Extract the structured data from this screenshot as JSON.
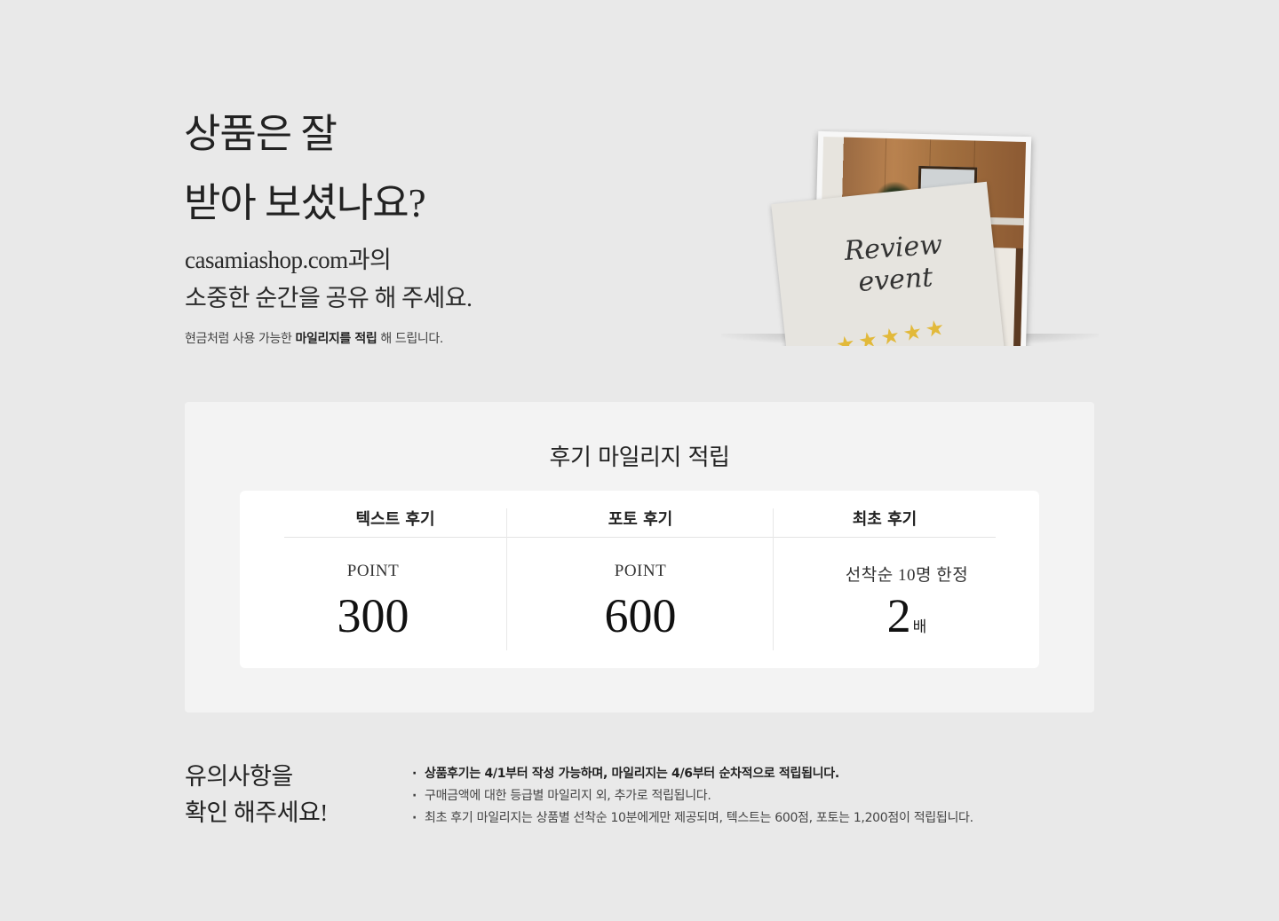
{
  "hero": {
    "title_line1": "상품은 잘",
    "title_line2": "받아 보셨나요?",
    "sub_line1": "casamiashop.com과의",
    "sub_line2": "소중한 순간을 공유 해 주세요.",
    "note_prefix": "현금처럼 사용 가능한 ",
    "note_bold": "마일리지를 적립",
    "note_suffix": " 해 드립니다."
  },
  "illustration": {
    "card_line1": "Review",
    "card_line2": "event",
    "stars": "★★★★★",
    "star_color": "#e2b93a"
  },
  "mileage": {
    "title": "후기 마일리지 적립",
    "columns": [
      {
        "header": "텍스트 후기",
        "label": "POINT",
        "value": "300",
        "unit": ""
      },
      {
        "header": "포토 후기",
        "label": "POINT",
        "value": "600",
        "unit": ""
      },
      {
        "header": "최초 후기",
        "label": "선착순 10명 한정",
        "value": "2",
        "unit": "배"
      }
    ]
  },
  "notice": {
    "title_line1": "유의사항을",
    "title_line2": "확인 해주세요!",
    "items": [
      "상품후기는 4/1부터 작성 가능하며, 마일리지는 4/6부터 순차적으로 적립됩니다.",
      "구매금액에 대한 등급별 마일리지 외, 추가로 적립됩니다.",
      "최초 후기 마일리지는 상품별 선착순 10분에게만 제공되며, 텍스트는 600점, 포토는 1,200점이 적립됩니다."
    ]
  },
  "colors": {
    "page_bg": "#e9e9e9",
    "box_bg": "#f3f3f3",
    "panel_bg": "#ffffff"
  }
}
